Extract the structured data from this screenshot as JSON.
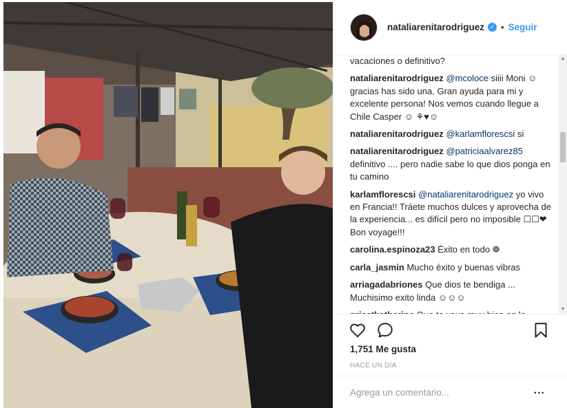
{
  "header": {
    "username": "nataliarenitarodriguez",
    "verified_glyph": "✓",
    "separator": "•",
    "follow_label": "Seguir"
  },
  "comments": [
    {
      "user": "",
      "parts": [
        {
          "t": "vacaciones o definitivo?",
          "m": false
        }
      ]
    },
    {
      "user": "nataliarenitarodriguez",
      "parts": [
        {
          "t": "@mcoloce",
          "m": true
        },
        {
          "t": " siiii Moni ☺ gracias has sido una. Gran ayuda para mi y excelente persona! Nos vemos cuando llegue a Chile Casper ☺ ⚘♥☺",
          "m": false
        }
      ]
    },
    {
      "user": "nataliarenitarodriguez",
      "parts": [
        {
          "t": "@karlamflorescsi",
          "m": true
        },
        {
          "t": " si",
          "m": false
        }
      ]
    },
    {
      "user": "nataliarenitarodriguez",
      "parts": [
        {
          "t": "@patriciaalvarez85",
          "m": true
        },
        {
          "t": " definitivo .... pero nadie sabe lo que dios ponga en tu camino",
          "m": false
        }
      ]
    },
    {
      "user": "karlamflorescsi",
      "parts": [
        {
          "t": "@nataliarenitarodriguez",
          "m": true
        },
        {
          "t": " yo vivo en Francia!! Tráete muchos dulces y aprovecha de la experiencia... es difícil pero no imposible ☐☐❤ Bon voyage!!!",
          "m": false
        }
      ]
    },
    {
      "user": "carolina.espinoza23",
      "parts": [
        {
          "t": "Éxito en todo ❁",
          "m": false
        }
      ]
    },
    {
      "user": "carla_jasmin",
      "parts": [
        {
          "t": "Mucho éxito y buenas vibras",
          "m": false
        }
      ]
    },
    {
      "user": "arriagadabriones",
      "parts": [
        {
          "t": "Que dios te bendiga ... Muchisimo exito linda ☺☺☺",
          "m": false
        }
      ]
    },
    {
      "user": "grisetkatherine",
      "parts": [
        {
          "t": "Que te vaya muy bien en lo",
          "m": false
        }
      ]
    }
  ],
  "actions": {
    "like_icon": "heart-outline",
    "comment_icon": "speech-bubble-outline",
    "save_icon": "bookmark-outline"
  },
  "likes_text": "1,751 Me gusta",
  "time_text": "HACE UN DÍA",
  "add_comment": {
    "placeholder": "Agrega un comentario...",
    "more": "..."
  },
  "colors": {
    "link": "#3897f0",
    "mention": "#003569",
    "text": "#262626",
    "muted": "#999999",
    "border": "#efefef"
  }
}
